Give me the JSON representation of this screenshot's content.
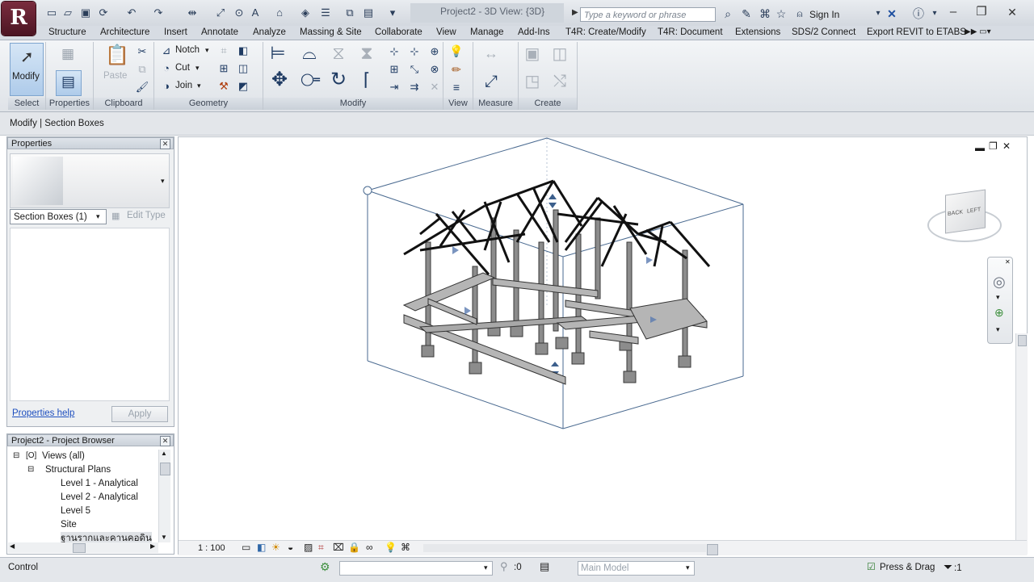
{
  "titlebar": {
    "app_letter": "R",
    "window_title": "Project2 - 3D View: {3D}",
    "search_placeholder": "Type a keyword or phrase",
    "sign_in": "Sign In"
  },
  "tabs": [
    "Structure",
    "Architecture",
    "Insert",
    "Annotate",
    "Analyze",
    "Massing & Site",
    "Collaborate",
    "View",
    "Manage",
    "Add-Ins",
    "T4R: Create/Modify",
    "T4R: Document",
    "Extensions",
    "SDS/2 Connect",
    "Export REVIT to ETABS"
  ],
  "ribbon": {
    "modify_label": "Modify",
    "paste_label": "Paste",
    "notch_label": "Notch",
    "cut_label": "Cut",
    "join_label": "Join",
    "panels": {
      "select": "Select",
      "properties": "Properties",
      "clipboard": "Clipboard",
      "geometry": "Geometry",
      "modify": "Modify",
      "view": "View",
      "measure": "Measure",
      "create": "Create"
    }
  },
  "context_bar": {
    "text": "Modify | Section Boxes"
  },
  "properties": {
    "header": "Properties",
    "type_selector": "Section Boxes (1)",
    "edit_type": "Edit Type",
    "help_link": "Properties help",
    "apply": "Apply"
  },
  "project_browser": {
    "header": "Project2 - Project Browser",
    "views_all": "Views (all)",
    "structural_plans": "Structural Plans",
    "items": [
      "Level 1 - Analytical",
      "Level 2 - Analytical",
      "Level 5",
      "Site",
      "ฐานรากและคานคอดิน"
    ]
  },
  "view": {
    "scale": "1 : 100",
    "viewcube_left": "LEFT",
    "viewcube_back": "BACK"
  },
  "statusbar": {
    "mode": "Control",
    "workset_count": ":0",
    "model": "Main Model",
    "press_drag": "Press & Drag",
    "filter_count": ":1"
  }
}
